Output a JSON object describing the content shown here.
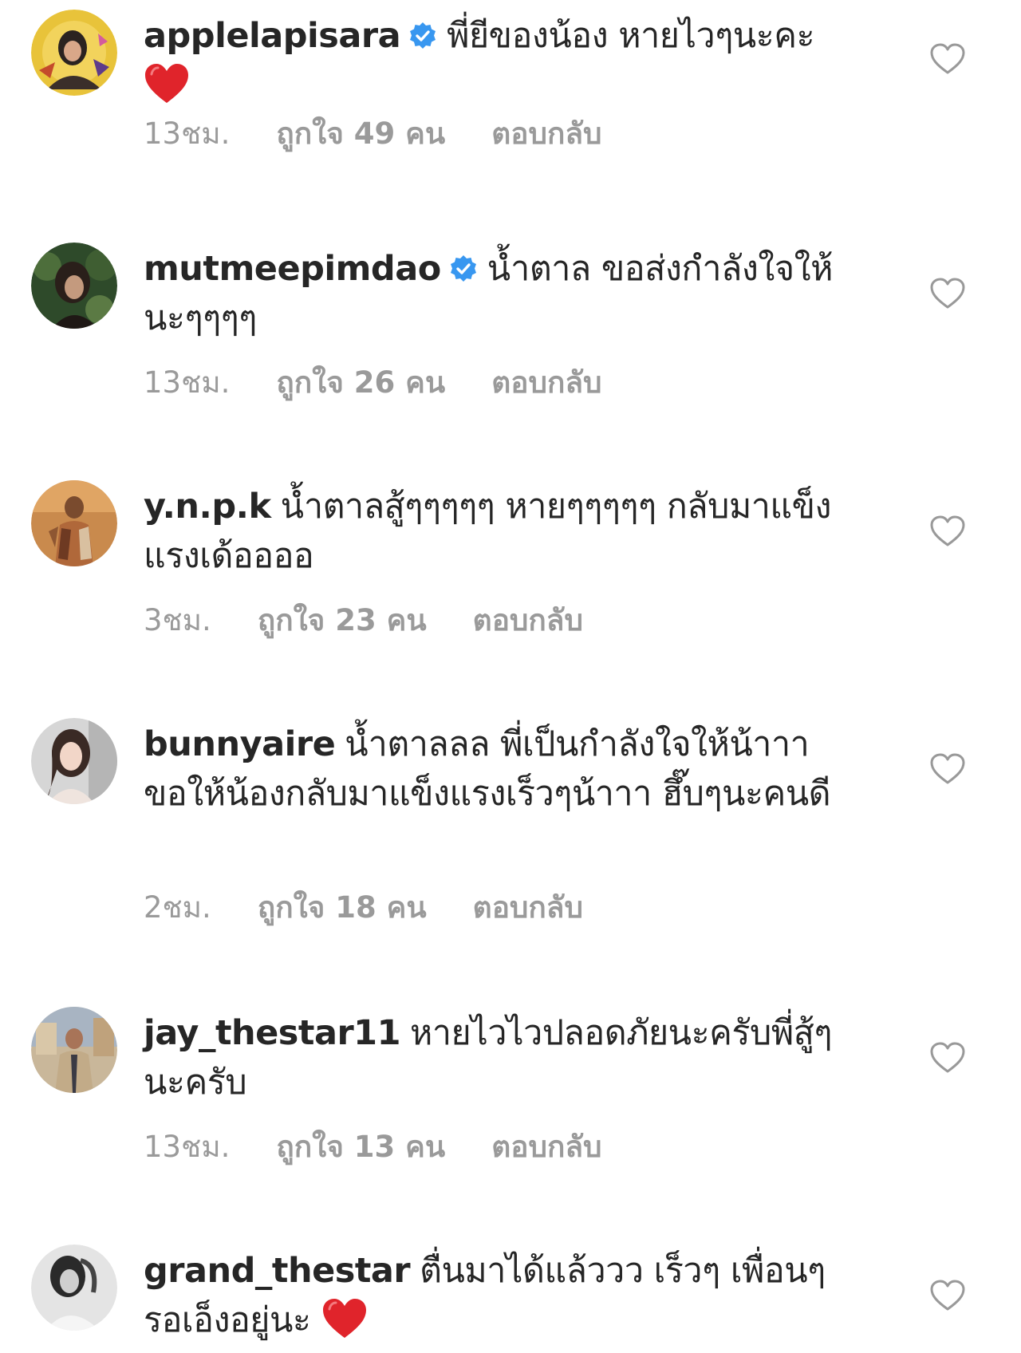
{
  "comments": [
    {
      "username": "applelapisara",
      "verified": true,
      "text": "พี่ยีของน้อง หายไวๆนะคะ",
      "emoji_heart": true,
      "time": "13ชม.",
      "likes": "ถูกใจ 49 คน",
      "reply": "ตอบกลับ"
    },
    {
      "username": "mutmeepimdao",
      "verified": true,
      "text": "น้ำตาล ขอส่งกำลังใจให้นะๆๆๆๆ",
      "emoji_heart": false,
      "time": "13ชม.",
      "likes": "ถูกใจ 26 คน",
      "reply": "ตอบกลับ"
    },
    {
      "username": "y.n.p.k",
      "verified": false,
      "text": "น้ำตาลสู้ๆๆๆๆๆ หายๆๆๆๆๆ กลับมาแข็งแรงเด้ออออ",
      "emoji_heart": false,
      "time": "3ชม.",
      "likes": "ถูกใจ 23 คน",
      "reply": "ตอบกลับ"
    },
    {
      "username": "bunnyaire",
      "verified": false,
      "text": "น้ำตาลลล พี่เป็นกำลังใจให้น้าาา ขอให้น้องกลับมาแข็งแรงเร็วๆน้าาา ฮึ๊บๆนะคนดี",
      "emoji_heart": false,
      "time": "2ชม.",
      "likes": "ถูกใจ 18 คน",
      "reply": "ตอบกลับ"
    },
    {
      "username": "jay_thestar11",
      "verified": false,
      "text": "หายไวไวปลอดภัยนะครับพี่สู้ๆนะครับ",
      "emoji_heart": false,
      "time": "13ชม.",
      "likes": "ถูกใจ 13 คน",
      "reply": "ตอบกลับ"
    },
    {
      "username": "grand_thestar",
      "verified": false,
      "text": "ตื่นมาได้แล้ววว เร็วๆ เพื่อนๆรอเอ็งอยู่นะ",
      "emoji_heart": true
    }
  ],
  "icons": {
    "verified_badge": "verified-badge-icon",
    "like": "heart-outline-icon",
    "emoji": "red-heart-emoji"
  },
  "colors": {
    "verified": "#3897f0",
    "meta_text": "#9a9a9a",
    "text": "#262626",
    "emoji_heart": "#e0242b"
  }
}
